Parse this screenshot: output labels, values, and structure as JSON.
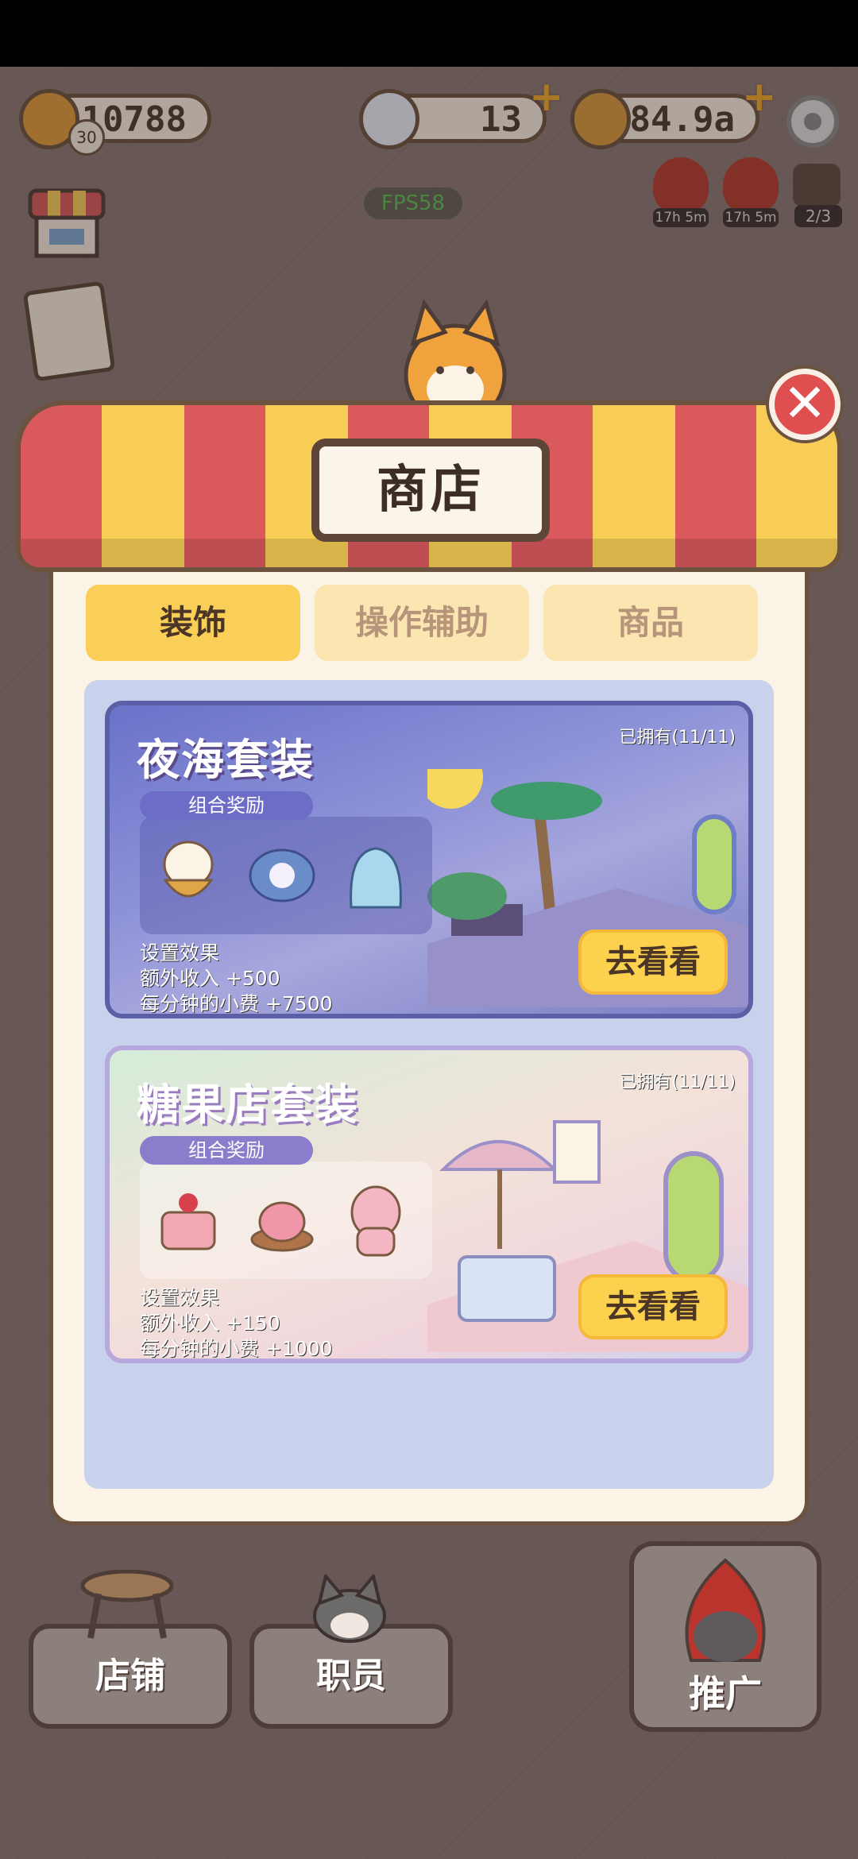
{
  "hud": {
    "coins": "10788",
    "level": "30",
    "gems": "13",
    "cookies": "184.9a",
    "fps": "FPS58",
    "timer1": "17h 5m",
    "timer2": "17h 5m",
    "promo_count": "2/3"
  },
  "shop": {
    "title": "商店",
    "tabs": [
      {
        "label": "装饰",
        "active": true
      },
      {
        "label": "操作辅助",
        "active": false
      },
      {
        "label": "商品",
        "active": false
      }
    ],
    "cards": [
      {
        "title": "夜海套装",
        "owned": "已拥有(11/11)",
        "reward_label": "组合奖励",
        "effect_title": "设置效果",
        "income": "额外收入  +500",
        "tip": "每分钟的小费  +7500",
        "button": "去看看"
      },
      {
        "title": "糖果店套装",
        "owned": "已拥有(11/11)",
        "reward_label": "组合奖励",
        "effect_title": "设置效果",
        "income": "额外收入  +150",
        "tip": "每分钟的小费  +1000",
        "button": "去看看"
      }
    ]
  },
  "nav": {
    "store": "店铺",
    "staff": "职员",
    "promote": "推广"
  },
  "colors": {
    "awning_red": "#d9595d",
    "awning_yellow": "#f7cd56",
    "tab_active": "#f9cf58",
    "button": "#fbd14e",
    "close": "#e04f4f"
  }
}
